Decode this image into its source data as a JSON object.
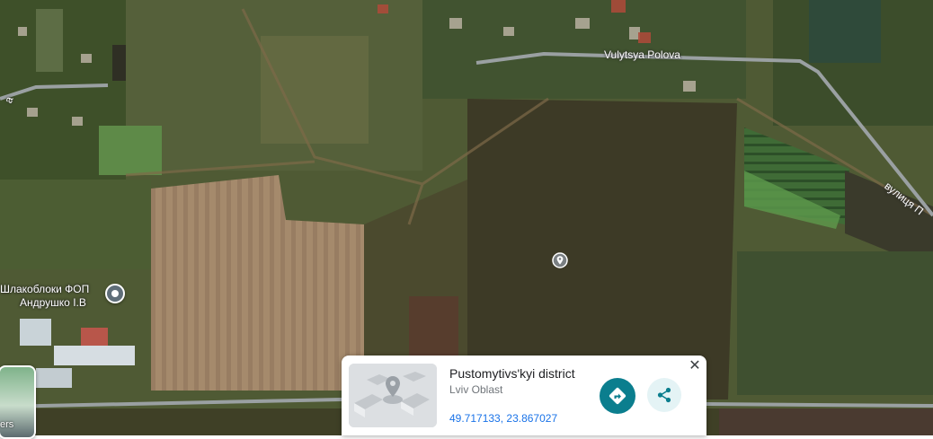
{
  "map": {
    "type": "satellite",
    "roads": {
      "polova": "Vulytsya Polova",
      "pershotravneva": "вулиця П",
      "left_street": "a"
    },
    "poi": {
      "line1": "Шлакоблоки ФОП",
      "line2": "Андрушко І.В",
      "icon": "pin-icon"
    },
    "dropped_pin_icon": "location-pin-icon"
  },
  "layers_control": {
    "label": "ers"
  },
  "place_card": {
    "title": "Pustomytivs'kyi district",
    "subtitle": "Lviv Oblast",
    "coordinates": "49.717133, 23.867027",
    "directions_icon": "directions-icon",
    "share_icon": "share-icon",
    "close_icon": "close-icon",
    "close_glyph": "✕",
    "accent_color": "#0b7e8e"
  }
}
